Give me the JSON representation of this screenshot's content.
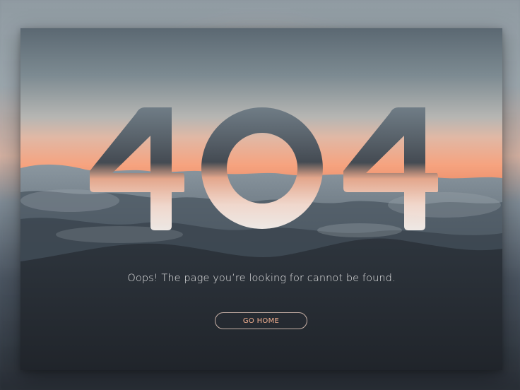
{
  "error": {
    "code": "404",
    "message": "Oops! The page you’re looking for cannot be found.",
    "button_label": "GO HOME"
  },
  "colors": {
    "accent": "#f3b090",
    "text": "#f2f2f2",
    "sky_top": "#5b6872",
    "sunset": "#f6a37f",
    "dark": "#23282f"
  }
}
